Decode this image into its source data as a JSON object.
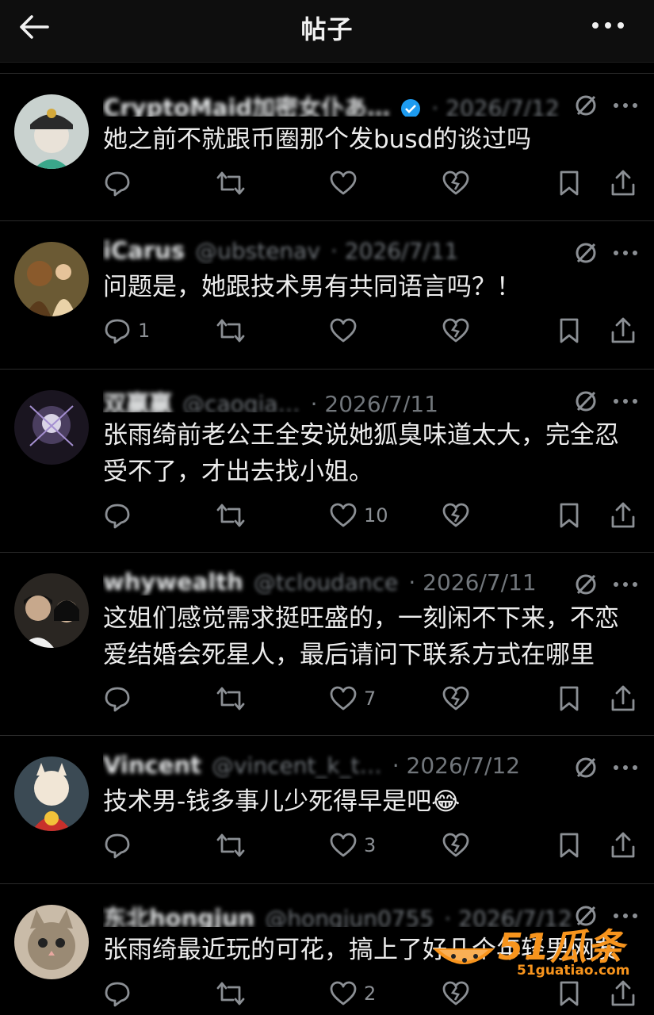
{
  "header": {
    "title": "帖子",
    "back_icon": "back-arrow-icon",
    "more_icon": "more-icon"
  },
  "colors": {
    "background": "#000000",
    "text": "#e7e9ea",
    "muted": "#71767b",
    "verified": "#1d9bf0",
    "watermark": "#f7941d"
  },
  "replies": [
    {
      "name": "CryptoMaid加密女仆あ…",
      "handle": "",
      "date": "2026/7/12",
      "text": "她之前不就跟币圈那个发busd的谈过吗",
      "reply_count": "",
      "like_count": ""
    },
    {
      "name": "iCarus",
      "handle": "@ubstenav",
      "date": "2026/7/11",
      "text": "问题是，她跟技术男有共同语言吗？！",
      "reply_count": "1",
      "like_count": ""
    },
    {
      "name": "双赢赢",
      "handle": "@caoqia…",
      "date": "2026/7/11",
      "text": "张雨绮前老公王全安说她狐臭味道太大，完全忍受不了，才出去找小姐。",
      "reply_count": "",
      "like_count": "10"
    },
    {
      "name": "whywealth",
      "handle": "@tcloudance",
      "date": "2026/7/11",
      "text": "这姐们感觉需求挺旺盛的，一刻闲不下来，不恋爱结婚会死星人，最后请问下联系方式在哪里",
      "reply_count": "",
      "like_count": "7"
    },
    {
      "name": "Vincent",
      "handle": "@vincent_k_t…",
      "date": "2026/7/12",
      "text": "技术男-钱多事儿少死得早是吧😂",
      "reply_count": "",
      "like_count": "3"
    },
    {
      "name": "东北hongjun",
      "handle": "@hongjun0755",
      "date": "2026/7/12",
      "text": "张雨绮最近玩的可花，搞上了好几个年轻男网友",
      "reply_count": "",
      "like_count": "2"
    }
  ],
  "watermark": {
    "brand": "51瓜条",
    "url": "51guatiao.com"
  }
}
